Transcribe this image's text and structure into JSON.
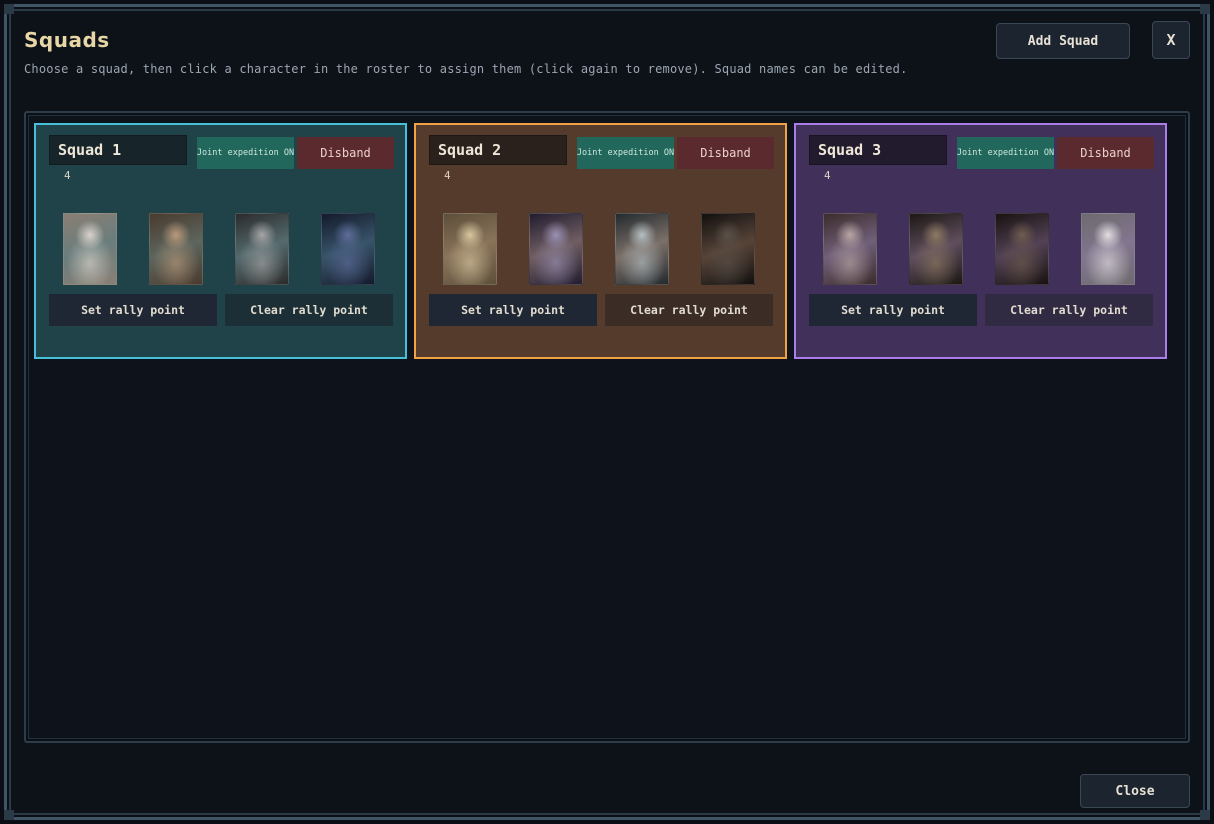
{
  "header": {
    "title": "Squads",
    "subtitle": "Choose a squad, then click a character in the roster to assign them (click again to remove). Squad names can be edited.",
    "add_squad_label": "Add Squad",
    "close_x_label": "X"
  },
  "footer": {
    "close_label": "Close"
  },
  "squads": [
    {
      "name": "Squad 1",
      "count": "4",
      "joint_label": "Joint expedition ON",
      "disband_label": "Disband",
      "set_rally_label": "Set rally point",
      "clear_rally_label": "Clear rally point",
      "accent_color": "#47bfd8",
      "portraits": [
        {
          "colors": [
            "#d9d4cb",
            "#8a7f74"
          ]
        },
        {
          "colors": [
            "#b99a7c",
            "#4a3a2e"
          ]
        },
        {
          "colors": [
            "#a6a6a6",
            "#2b2b2b"
          ]
        },
        {
          "colors": [
            "#5d6d9a",
            "#141a2c"
          ]
        }
      ]
    },
    {
      "name": "Squad 2",
      "count": "4",
      "joint_label": "Joint expedition ON",
      "disband_label": "Disband",
      "set_rally_label": "Set rally point",
      "clear_rally_label": "Clear rally point",
      "accent_color": "#f0a344",
      "portraits": [
        {
          "colors": [
            "#d8c79f",
            "#5c4f3a"
          ]
        },
        {
          "colors": [
            "#9a92b5",
            "#221d30"
          ]
        },
        {
          "colors": [
            "#b7c0c4",
            "#232a2e"
          ]
        },
        {
          "colors": [
            "#5a5149",
            "#121010"
          ]
        }
      ]
    },
    {
      "name": "Squad 3",
      "count": "4",
      "joint_label": "Joint expedition ON",
      "disband_label": "Disband",
      "set_rally_label": "Set rally point",
      "clear_rally_label": "Clear rally point",
      "accent_color": "#a97ee8",
      "portraits": [
        {
          "colors": [
            "#b9a7a6",
            "#3b2c2c"
          ]
        },
        {
          "colors": [
            "#8d7a62",
            "#1c1814"
          ]
        },
        {
          "colors": [
            "#6e5c4e",
            "#181210"
          ]
        },
        {
          "colors": [
            "#e2dfe0",
            "#6d6a6e"
          ]
        }
      ]
    }
  ]
}
